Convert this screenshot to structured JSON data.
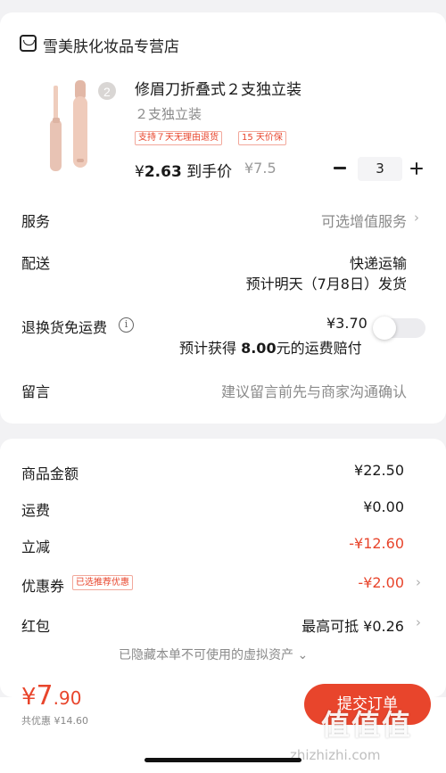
{
  "store": {
    "name": "雪美肤化妆品专营店",
    "icon": "store-icon"
  },
  "product": {
    "title": "修眉刀折叠式２支独立装",
    "spec": "２支独立装",
    "image_badge": "2",
    "tags": [
      "支持７天无理由退货",
      "15 天价保"
    ],
    "price_currency": "¥",
    "price_value": "2.63",
    "price_suffix": " 到手价",
    "original_price": "¥7.5",
    "quantity": "3"
  },
  "rows": {
    "service": {
      "label": "服务",
      "value": "可选增值服务"
    },
    "delivery": {
      "label": "配送",
      "method": "快递运输",
      "eta": "预计明天（7月8日）发货"
    },
    "return_shipping": {
      "label": "退换货免运费",
      "info_icon": "i",
      "price": "¥3.70",
      "note_prefix": "预计获得 ",
      "note_amount": "8.00",
      "note_suffix": "元的运费赔付",
      "toggle_on": false
    },
    "message": {
      "label": "留言",
      "placeholder": "建议留言前先与商家沟通确认"
    }
  },
  "summary": {
    "goods_amount": {
      "label": "商品金额",
      "value": "¥22.50"
    },
    "shipping": {
      "label": "运费",
      "value": "¥0.00"
    },
    "instant_discount": {
      "label": "立减",
      "value": "-¥12.60"
    },
    "coupon": {
      "label": "优惠券",
      "badge": "已选推荐优惠",
      "value": "-¥2.00"
    },
    "red_packet": {
      "label": "红包",
      "value": "最高可抵 ¥0.26"
    },
    "hidden_note": "已隐藏本单不可使用的虚拟资产"
  },
  "footer": {
    "total_currency": "¥",
    "total_int": "7",
    "total_dec": ".90",
    "saved": "共优惠 ¥14.60",
    "submit_label": "提交订单"
  },
  "watermark": {
    "logo": "值值值",
    "url": "zhizhizhi.com"
  },
  "colors": {
    "accent": "#e8452c",
    "background": "#f2f2f4"
  }
}
